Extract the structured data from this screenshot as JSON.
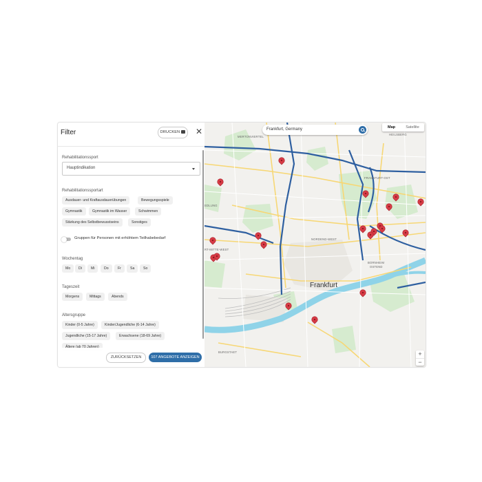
{
  "panel": {
    "title": "Filter",
    "print_label": "DRUCKEN",
    "close_label": "✕"
  },
  "rehabsport": {
    "label": "Rehabilitationssport",
    "select_value": "Hauptindikation"
  },
  "sportart": {
    "label": "Rehabilitationssportart",
    "chips": [
      "Ausdauer- und Kraftausdauerübungen",
      "Bewegungsspiele",
      "Gymnastik",
      "Gymnastik im Wasser",
      "Schwimmen",
      "Stärkung des Selbstbewusstseins",
      "Sonstiges"
    ]
  },
  "toggle": {
    "label": "Gruppen für Personen mit erhöhtem Teilhabebedarf"
  },
  "wochentag": {
    "label": "Wochentag",
    "chips": [
      "Mo",
      "Di",
      "Mi",
      "Do",
      "Fr",
      "Sa",
      "So"
    ]
  },
  "tageszeit": {
    "label": "Tageszeit",
    "chips": [
      "Morgens",
      "Mittags",
      "Abends"
    ]
  },
  "altersgruppe": {
    "label": "Altersgruppe",
    "chips": [
      "Kinder (0-5 Jahre)",
      "Kinder/Jugendliche (6-14 Jahre)",
      "Jugendliche (15-17 Jahre)",
      "Erwachsene (18-69 Jahre)",
      "Ältere (ab 70 Jahren)"
    ]
  },
  "footer": {
    "reset_label": "ZURÜCKSETZEN",
    "show_label": "107 ANGEBOTE ANZEIGEN"
  },
  "map": {
    "search_value": "Frankfurt, Germany",
    "maptype_map": "Map",
    "maptype_satellite": "Satellite",
    "zoom_in": "+",
    "zoom_out": "−",
    "city_label": "Frankfurt",
    "labels": {
      "heilsberg": "HEILSBERG",
      "mertonviertel": "MERTONVIERTEL",
      "frankfurt_ost": "FRANKFURT-OST",
      "nordend_west": "NORDEND-WEST",
      "bornheim": "BORNHEIM",
      "ostend": "OSTEND",
      "mitte_west": "RT-MITTE-WEST",
      "ledling": "EDLUNG",
      "bonames": "BURGSTAET"
    },
    "colors": {
      "pin": "#d63b45",
      "water": "#8fd3e8",
      "park": "#cfe8c8",
      "road_major": "#2e5fa0",
      "road_minor": "#fbe39a"
    }
  }
}
